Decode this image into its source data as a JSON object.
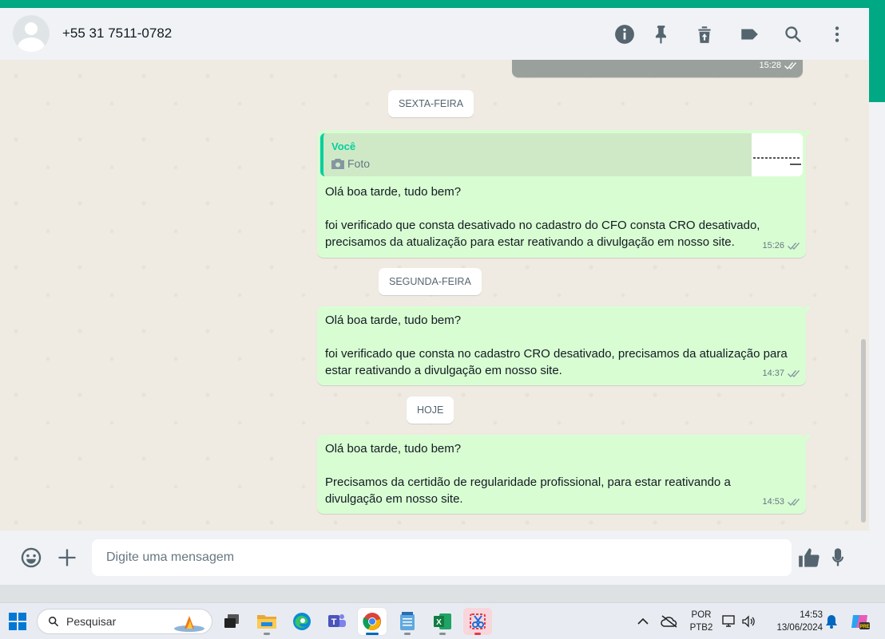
{
  "header": {
    "contact_name": "+55 31 7511-0782",
    "icons": [
      "info-icon",
      "pin-icon",
      "trash-icon",
      "label-icon",
      "search-icon",
      "menu-icon"
    ]
  },
  "chat": {
    "partial_top_time": "15:28",
    "days": [
      {
        "date_label": "SEXTA-FEIRA",
        "message": {
          "quote_author": "Você",
          "quote_type": "Foto",
          "text": "Olá boa tarde, tudo bem?\n\nfoi verificado que consta desativado no cadastro do CFO consta CRO desativado,\nprecisamos da atualização para estar reativando a divulgação em nosso site.",
          "time": "15:26",
          "status": "read"
        }
      },
      {
        "date_label": "SEGUNDA-FEIRA",
        "message": {
          "text": "Olá boa tarde, tudo bem?\n\nfoi verificado que consta no cadastro CRO desativado, precisamos da atualização para\nestar reativando a divulgação em nosso site.",
          "time": "14:37",
          "status": "read"
        }
      },
      {
        "date_label": "HOJE",
        "message": {
          "text": "Olá boa tarde, tudo bem?\n\nPrecisamos da certidão de regularidade profissional, para estar reativando a\ndivulgação em nosso site.",
          "time": "14:53",
          "status": "read"
        }
      }
    ]
  },
  "composer": {
    "placeholder": "Digite uma mensagem",
    "icons": [
      "emoji-icon",
      "plus-icon",
      "like-icon",
      "microphone-icon"
    ]
  },
  "taskbar": {
    "search_label": "Pesquisar",
    "apps": [
      "start-icon",
      "task-view-icon",
      "file-explorer-icon",
      "edge-icon",
      "teams-icon",
      "chrome-icon",
      "notepad-icon",
      "excel-icon",
      "snipping-tool-icon"
    ],
    "language": "POR",
    "keyboard": "PTB2",
    "time": "14:53",
    "date": "13/06/2024",
    "colors": {
      "accent": "#0067c0",
      "whatsapp_green": "#00a884",
      "bubble": "#d9fdd3"
    }
  }
}
